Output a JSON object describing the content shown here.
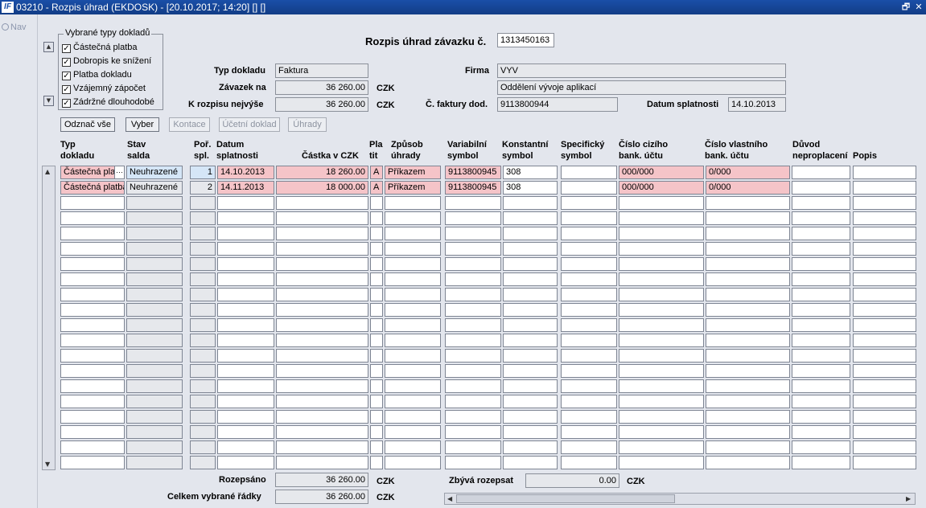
{
  "window": {
    "title": "03210 - Rozpis úhrad (EKDOSK) - [20.10.2017; 14:20] [] []",
    "logo": "IF",
    "restore_glyph": "🗗",
    "close_glyph": "✕"
  },
  "nav": {
    "label": "Nav"
  },
  "filter": {
    "title": "Vybrané typy dokladů",
    "items": [
      {
        "label": "Částečná platba",
        "checked": true
      },
      {
        "label": "Dobropis ke snížení",
        "checked": true
      },
      {
        "label": "Platba dokladu",
        "checked": true
      },
      {
        "label": "Vzájemný zápočet",
        "checked": true
      },
      {
        "label": "Zádržné dlouhodobé",
        "checked": true
      }
    ],
    "check_glyph": "✓"
  },
  "header": {
    "heading": "Rozpis úhrad závazku č.",
    "number": "1313450163",
    "typ_dokladu_label": "Typ dokladu",
    "typ_dokladu": "Faktura",
    "zavazek_label": "Závazek na",
    "zavazek": "36 260.00",
    "zavazek_currency": "CZK",
    "k_rozpisu_label": "K rozpisu nejvýše",
    "k_rozpisu": "36 260.00",
    "k_rozpisu_currency": "CZK",
    "firma_label": "Firma",
    "firma": "VYV",
    "oddeleni": "Oddělení vývoje aplikací",
    "faktura_label": "Č. faktury dod.",
    "faktura": "9113800944",
    "splatnost_label": "Datum splatnosti",
    "splatnost": "14.10.2013"
  },
  "buttons": {
    "oznac_vse": "Odznač vše",
    "vyber": "Vyber",
    "kontace": "Kontace",
    "ucetni_doklad": "Účetní doklad",
    "uhrady": "Úhrady"
  },
  "columns": {
    "typ": "Typ\ndokladu",
    "stav": "Stav\nsalda",
    "por": "Poř.\nspl.",
    "datum": "Datum\nsplatnosti",
    "castka": "Částka v",
    "castka_currency": "CZK",
    "pla": "Pla\ntit",
    "zpusob": "Způsob\núhrady",
    "vs": "Variabilní\nsymbol",
    "ks": "Konstantní\nsymbol",
    "ss": "Specifický\nsymbol",
    "cizi": "Číslo cizího\nbank. účtu",
    "vlastni": "Číslo vlastního\nbank. účtu",
    "duvod": "Důvod\nneproplacení",
    "popis": "Popis"
  },
  "rows": [
    {
      "typ": "Částečná platba",
      "stav": "Neuhrazené",
      "por": "1",
      "datum": "14.10.2013",
      "castka": "18 260.00",
      "pla": "A",
      "zpusob": "Příkazem",
      "vs": "9113800945",
      "ks": "308",
      "ss": "",
      "cizi": "000/000",
      "vlastni": "0/000",
      "duvod": "",
      "popis": ""
    },
    {
      "typ": "Částečná platba",
      "stav": "Neuhrazené",
      "por": "2",
      "datum": "14.11.2013",
      "castka": "18 000.00",
      "pla": "A",
      "zpusob": "Příkazem",
      "vs": "9113800945",
      "ks": "308",
      "ss": "",
      "cizi": "000/000",
      "vlastni": "0/000",
      "duvod": "",
      "popis": ""
    }
  ],
  "ellipsis": "···",
  "footer": {
    "rozepsano_label": "Rozepsáno",
    "rozepsano": "36 260.00",
    "rozepsano_currency": "CZK",
    "celkem_label": "Celkem vybrané řádky",
    "celkem": "36 260.00",
    "celkem_currency": "CZK",
    "zbyva_label": "Zbývá rozepsat",
    "zbyva": "0.00",
    "zbyva_currency": "CZK"
  }
}
